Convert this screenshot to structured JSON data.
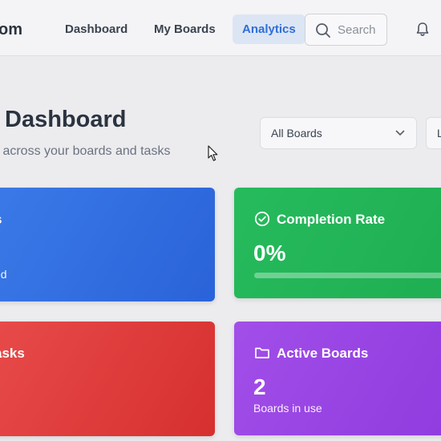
{
  "nav": {
    "brand": "om",
    "links": [
      {
        "label": "Dashboard",
        "active": false
      },
      {
        "label": "My Boards",
        "active": false
      },
      {
        "label": "Analytics",
        "active": true
      }
    ],
    "search_placeholder": "Search",
    "search_icon": "search-icon",
    "bell_icon": "bell-icon"
  },
  "header": {
    "title": "Dashboard",
    "subtitle": "s across your boards and tasks"
  },
  "filters": {
    "boards_select": "All Boards",
    "range_select": "L"
  },
  "cards": {
    "total": {
      "title": "s",
      "sub": "ed",
      "color": "#2f6fe0"
    },
    "completion": {
      "title": "Completion Rate",
      "value": "0%",
      "progress": 0,
      "icon": "check-circle-icon",
      "color": "#22b457"
    },
    "overdue": {
      "title": "asks",
      "color": "#e03b3b"
    },
    "boards": {
      "title": "Active Boards",
      "value": "2",
      "sub": "Boards in use",
      "icon": "folder-icon",
      "color": "#9846e4"
    }
  }
}
